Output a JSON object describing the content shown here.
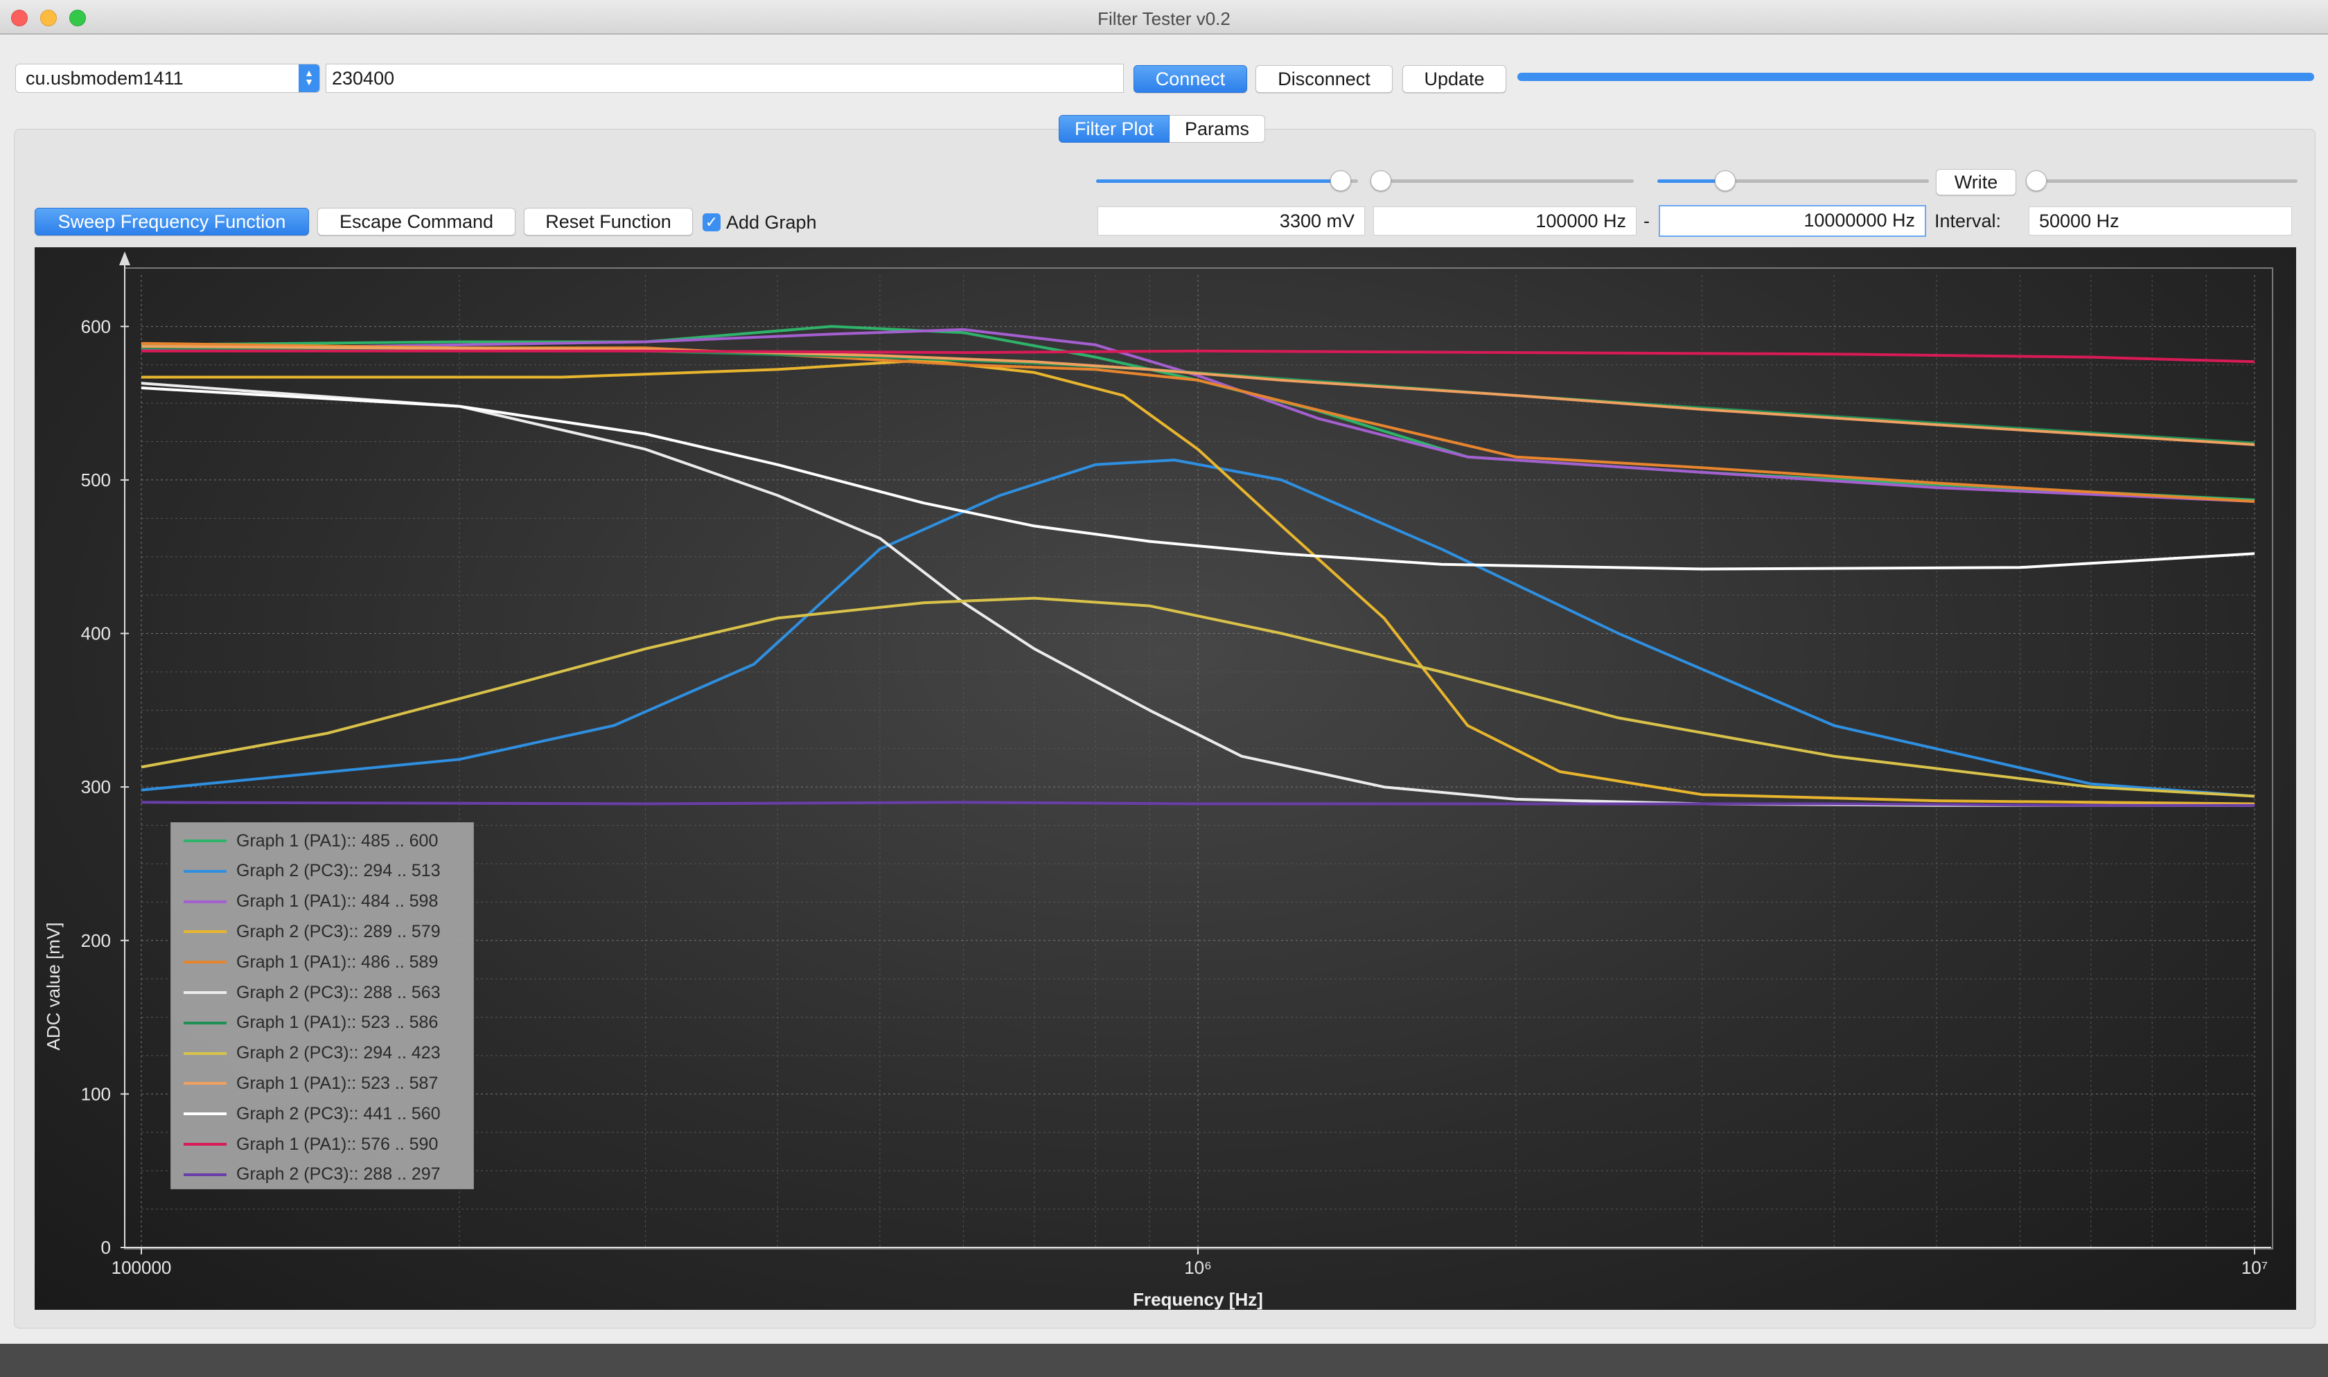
{
  "window": {
    "title": "Filter Tester v0.2"
  },
  "connection": {
    "port": "cu.usbmodem1411",
    "baud": "230400",
    "connect_label": "Connect",
    "disconnect_label": "Disconnect",
    "update_label": "Update",
    "progress": 1.0
  },
  "tabs": [
    {
      "label": "Filter Plot",
      "active": true
    },
    {
      "label": "Params",
      "active": false
    }
  ],
  "actions": {
    "sweep_label": "Sweep Frequency Function",
    "escape_label": "Escape Command",
    "reset_label": "Reset Function",
    "add_graph_label": "Add Graph",
    "add_graph_checked": true
  },
  "controls": {
    "slider_amplitude": 0.97,
    "slider_start": 0.0,
    "slider_stop": 0.23,
    "slider_interval": 0.0,
    "write_label": "Write",
    "amplitude": "3300 mV",
    "start_freq": "100000 Hz",
    "dash": "-",
    "stop_freq": "10000000 Hz",
    "interval_label": "Interval:",
    "interval": "50000 Hz"
  },
  "chart_data": {
    "type": "line",
    "xlabel": "Frequency [Hz]",
    "ylabel": "ADC value [mV]",
    "xscale": "log",
    "xlim": [
      100000,
      10000000
    ],
    "ylim": [
      0,
      620
    ],
    "xticks": [
      {
        "value": 100000,
        "label": "100000"
      },
      {
        "value": 1000000,
        "label": "10⁶"
      },
      {
        "value": 10000000,
        "label": "10⁷"
      }
    ],
    "yticks": [
      0,
      100,
      200,
      300,
      400,
      500,
      600
    ],
    "grid": true,
    "legend_position": "middle-left",
    "series": [
      {
        "name": "Graph 1 (PA1):: 485 .. 600",
        "color": "#2fb36a",
        "x": [
          100000,
          200000,
          300000,
          450000,
          600000,
          800000,
          1000000,
          1300000,
          1800000,
          3000000,
          5000000,
          10000000
        ],
        "y": [
          588,
          590,
          590,
          600,
          596,
          580,
          565,
          545,
          515,
          505,
          497,
          487
        ]
      },
      {
        "name": "Graph 2 (PC3):: 294 .. 513",
        "color": "#2f8fe0",
        "x": [
          100000,
          200000,
          280000,
          380000,
          500000,
          650000,
          800000,
          950000,
          1200000,
          1700000,
          2500000,
          4000000,
          7000000,
          10000000
        ],
        "y": [
          298,
          318,
          340,
          380,
          455,
          490,
          510,
          513,
          500,
          455,
          400,
          340,
          302,
          294
        ]
      },
      {
        "name": "Graph 1 (PA1):: 484 .. 598",
        "color": "#a45fd0",
        "x": [
          100000,
          200000,
          300000,
          450000,
          600000,
          800000,
          1000000,
          1300000,
          1800000,
          3000000,
          5000000,
          10000000
        ],
        "y": [
          585,
          588,
          590,
          595,
          598,
          588,
          568,
          540,
          515,
          505,
          495,
          486
        ]
      },
      {
        "name": "Graph 2 (PC3):: 289 .. 579",
        "color": "#e8b52e",
        "x": [
          100000,
          250000,
          400000,
          550000,
          700000,
          850000,
          1000000,
          1200000,
          1500000,
          1800000,
          2200000,
          3000000,
          5000000,
          10000000
        ],
        "y": [
          567,
          567,
          572,
          578,
          570,
          555,
          520,
          470,
          410,
          340,
          310,
          295,
          291,
          289
        ]
      },
      {
        "name": "Graph 1 (PA1):: 486 .. 589",
        "color": "#e7852e",
        "x": [
          100000,
          200000,
          300000,
          450000,
          600000,
          800000,
          1000000,
          1400000,
          2000000,
          3000000,
          5000000,
          10000000
        ],
        "y": [
          589,
          586,
          586,
          580,
          575,
          572,
          565,
          540,
          515,
          508,
          498,
          486
        ]
      },
      {
        "name": "Graph 2 (PC3):: 288 .. 563",
        "color": "#ececec",
        "x": [
          100000,
          200000,
          300000,
          400000,
          500000,
          600000,
          700000,
          900000,
          1100000,
          1500000,
          2000000,
          3000000,
          5000000,
          10000000
        ],
        "y": [
          563,
          548,
          520,
          490,
          462,
          420,
          390,
          350,
          320,
          300,
          292,
          289,
          288,
          288
        ]
      },
      {
        "name": "Graph 1 (PA1):: 523 .. 586",
        "color": "#1f8f55",
        "x": [
          100000,
          300000,
          500000,
          700000,
          900000,
          1200000,
          2000000,
          3000000,
          5000000,
          10000000
        ],
        "y": [
          586,
          584,
          580,
          576,
          572,
          566,
          555,
          547,
          537,
          524
        ]
      },
      {
        "name": "Graph 2 (PC3):: 294 .. 423",
        "color": "#d9c24a",
        "x": [
          100000,
          150000,
          220000,
          300000,
          400000,
          550000,
          700000,
          900000,
          1200000,
          1700000,
          2500000,
          4000000,
          7000000,
          10000000
        ],
        "y": [
          313,
          335,
          365,
          390,
          410,
          420,
          423,
          418,
          400,
          375,
          345,
          320,
          300,
          294
        ]
      },
      {
        "name": "Graph 1 (PA1):: 523 .. 587",
        "color": "#f0a060",
        "x": [
          100000,
          300000,
          500000,
          700000,
          900000,
          1200000,
          2000000,
          3000000,
          5000000,
          10000000
        ],
        "y": [
          587,
          585,
          581,
          577,
          572,
          565,
          555,
          546,
          536,
          523
        ]
      },
      {
        "name": "Graph 2 (PC3):: 441 .. 560",
        "color": "#ffffff",
        "x": [
          100000,
          200000,
          300000,
          400000,
          550000,
          700000,
          900000,
          1200000,
          1700000,
          3000000,
          6000000,
          10000000
        ],
        "y": [
          560,
          548,
          530,
          510,
          485,
          470,
          460,
          452,
          445,
          442,
          443,
          452
        ]
      },
      {
        "name": "Graph 1 (PA1):: 576 .. 590",
        "color": "#d81b57",
        "x": [
          100000,
          300000,
          600000,
          1000000,
          2000000,
          4000000,
          7000000,
          10000000
        ],
        "y": [
          584,
          584,
          583,
          584,
          583,
          582,
          580,
          577
        ]
      },
      {
        "name": "Graph 2 (PC3):: 288 .. 297",
        "color": "#6a3ea8",
        "x": [
          100000,
          300000,
          600000,
          1000000,
          2000000,
          4000000,
          7000000,
          10000000
        ],
        "y": [
          290,
          289,
          290,
          289,
          289,
          289,
          288,
          288
        ]
      }
    ]
  }
}
